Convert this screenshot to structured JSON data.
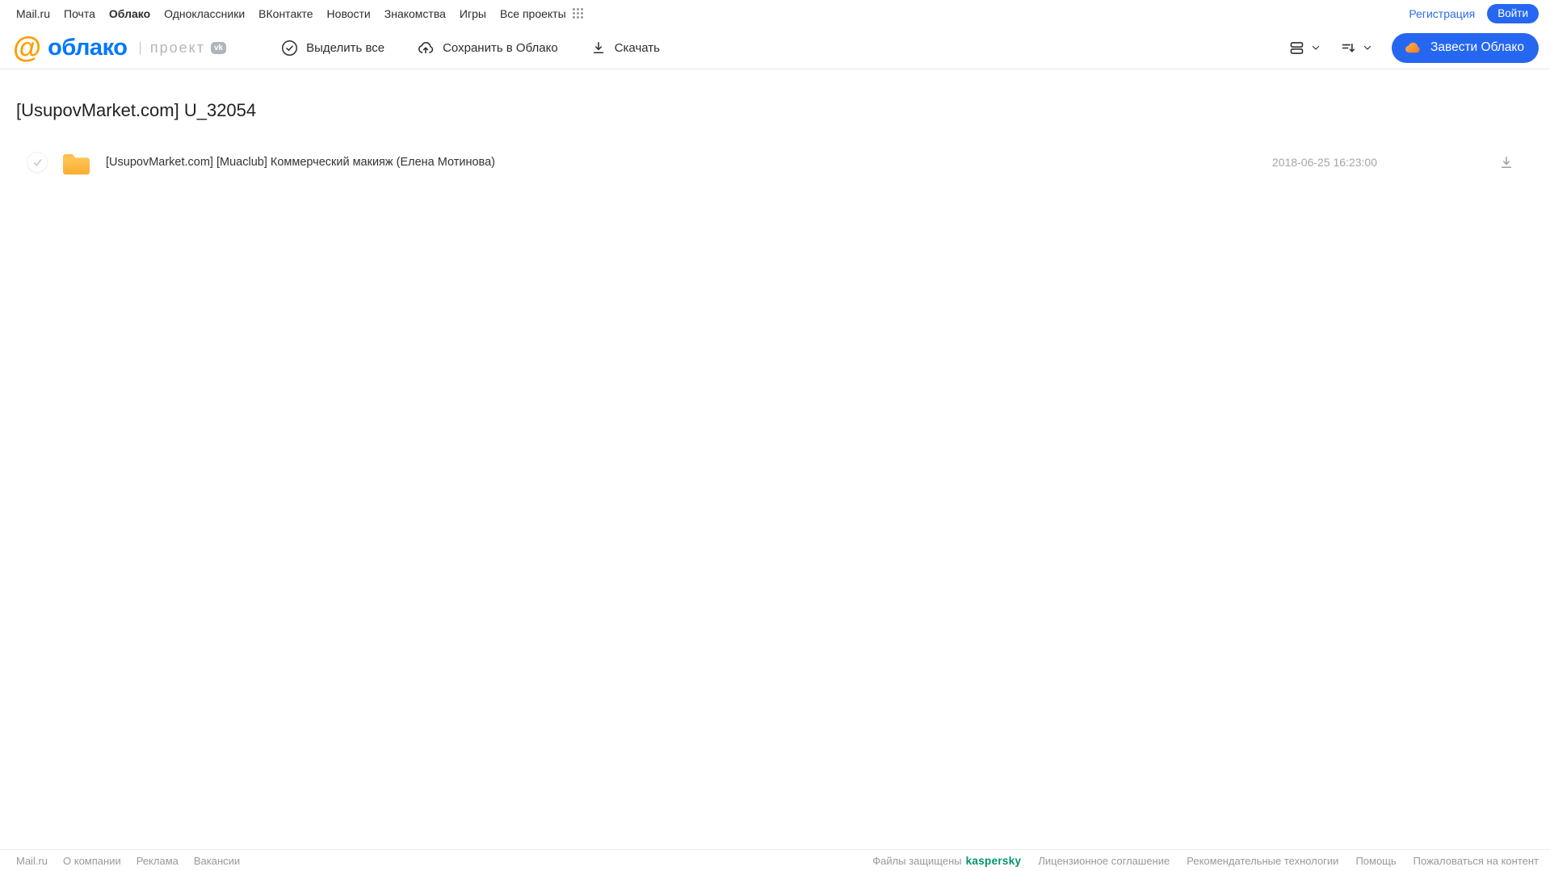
{
  "top_nav": {
    "links": [
      "Mail.ru",
      "Почта",
      "Облако",
      "Одноклассники",
      "ВКонтакте",
      "Новости",
      "Знакомства",
      "Игры",
      "Все проекты"
    ],
    "active_link": "Облако",
    "registration_label": "Регистрация",
    "login_label": "Войти"
  },
  "header": {
    "logo_at": "@",
    "logo_text": "облако",
    "divider": "|",
    "project_label": "проект",
    "vk_badge": "vk",
    "toolbar": {
      "select_all_label": "Выделить все",
      "save_to_cloud_label": "Сохранить в Облако",
      "download_label": "Скачать"
    },
    "get_cloud_label": "Завести Облако"
  },
  "main": {
    "title": "[UsupovMarket.com] U_32054",
    "files": [
      {
        "type": "folder",
        "name": "[UsupovMarket.com] [Muaclub] Коммерческий макияж (Елена Мотинова)",
        "date": "2018-06-25 16:23:00"
      }
    ]
  },
  "footer": {
    "left_links": [
      "Mail.ru",
      "О компании",
      "Реклама",
      "Вакансии"
    ],
    "protected_label": "Файлы защищены",
    "kaspersky_label": "kaspersky",
    "right_links": [
      "Лицензионное соглашение",
      "Рекомендательные технологии",
      "Помощь",
      "Пожаловаться на контент"
    ]
  },
  "icons": {
    "grid-icon": "3x3 dots all-projects grid",
    "check-circle-icon": "circled checkmark",
    "cloud-upload-icon": "cloud with up arrow",
    "download-icon": "down arrow over line",
    "list-view-icon": "two stacked bars",
    "chevron-down-icon": "chevron down",
    "sort-icon": "lines with down arrow",
    "cloud-icon": "orange cloud",
    "folder-icon": "yellow folder",
    "checkmark-icon": "light gray check"
  },
  "colors": {
    "accent_blue": "#2567f0",
    "logo_blue": "#0077ff",
    "logo_orange": "#ff9e00",
    "kaspersky_green": "#009470",
    "folder_yellow": "#fdb92e",
    "muted_gray": "#97999d"
  }
}
